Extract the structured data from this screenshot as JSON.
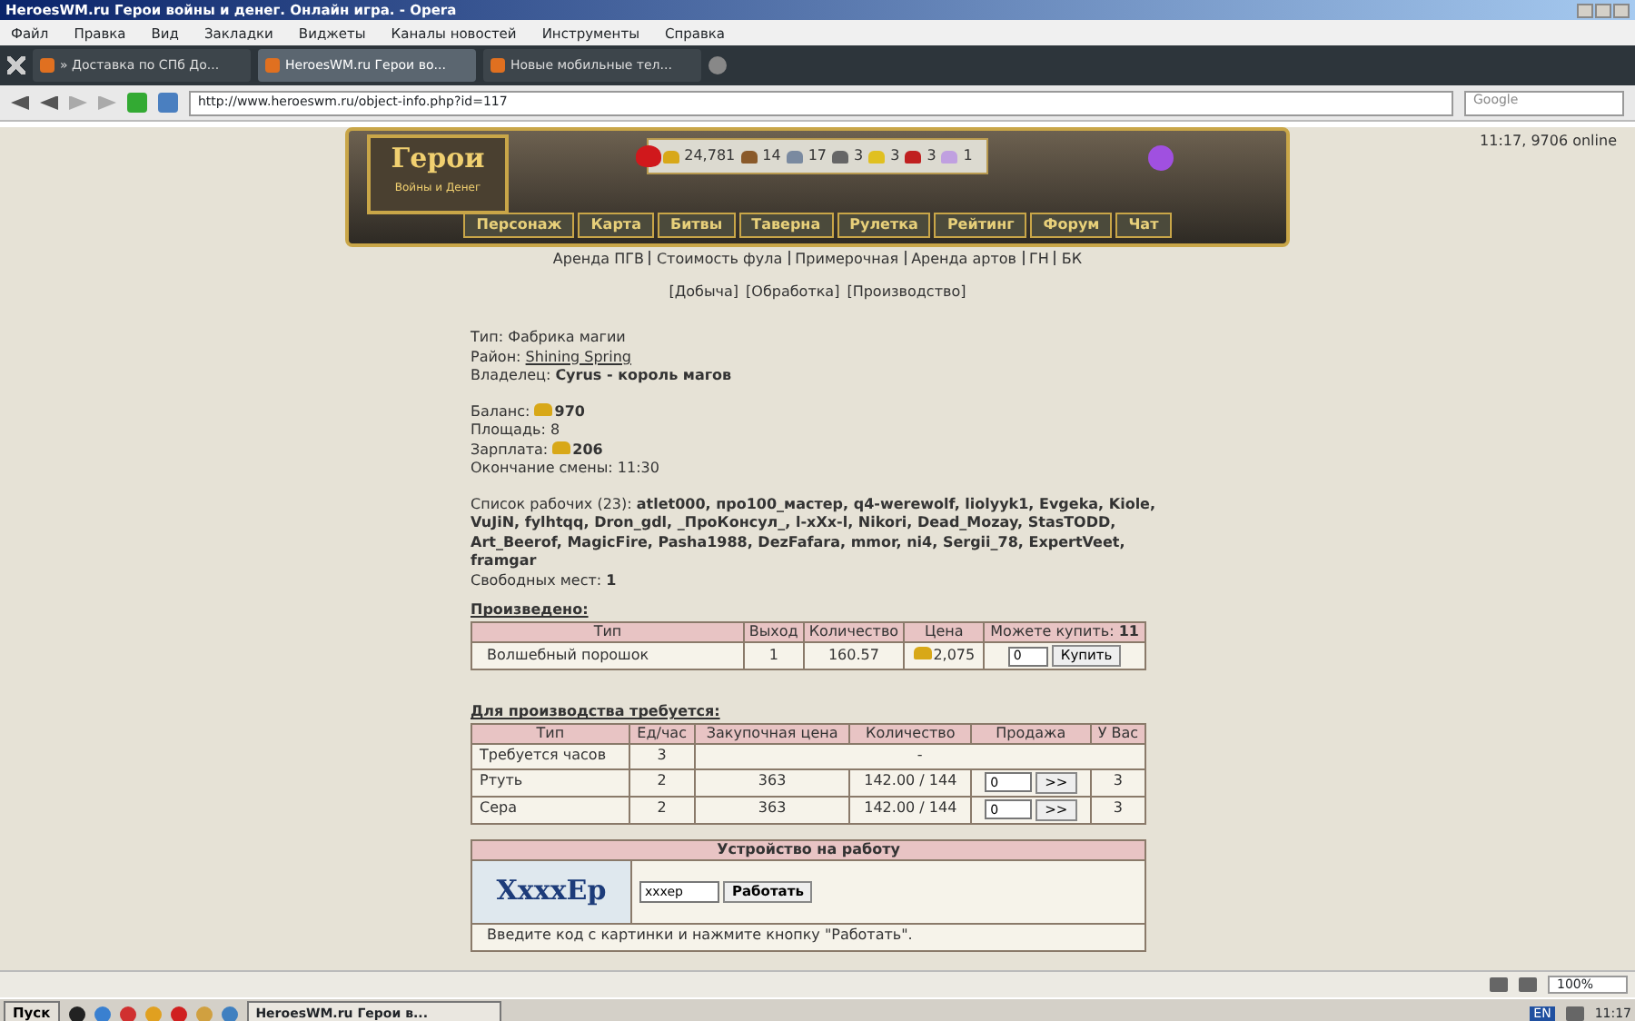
{
  "window": {
    "title": "HeroesWM.ru Герои войны и денег. Онлайн игра. - Opera"
  },
  "menu": [
    "Файл",
    "Правка",
    "Вид",
    "Закладки",
    "Виджеты",
    "Каналы новостей",
    "Инструменты",
    "Справка"
  ],
  "tabs": [
    {
      "label": "» Доставка по СПб До...",
      "selected": false
    },
    {
      "label": "HeroesWM.ru Герои во...",
      "selected": true
    },
    {
      "label": "Новые мобильные тел...",
      "selected": false
    }
  ],
  "address_bar": {
    "url": "http://www.heroeswm.ru/object-info.php?id=117",
    "search_placeholder": "Google"
  },
  "online": "11:17, 9706 online",
  "logo": {
    "title": "Герои",
    "subtitle": "Войны и Денег"
  },
  "resources": [
    {
      "amount": "24,781"
    },
    {
      "amount": "14"
    },
    {
      "amount": "17"
    },
    {
      "amount": "3"
    },
    {
      "amount": "3"
    },
    {
      "amount": "3"
    },
    {
      "amount": "1"
    }
  ],
  "nav": [
    "Персонаж",
    "Карта",
    "Битвы",
    "Таверна",
    "Рулетка",
    "Рейтинг",
    "Форум",
    "Чат"
  ],
  "links": [
    "Аренда ПГВ",
    "Стоимость фула",
    "Примерочная",
    "Аренда артов",
    "ГН",
    "БК"
  ],
  "sub_links": [
    "[Добыча]",
    "[Обработка]",
    "[Производство]"
  ],
  "info": [
    [
      {
        "label": "Тип:",
        "value": "Фабрика магии",
        "kind": "plain"
      },
      {
        "label": "Район:",
        "value": "Shining Spring",
        "kind": "link"
      },
      {
        "label": "Владелец:",
        "value": "Cyrus - король магов",
        "kind": "bold"
      }
    ],
    [
      {
        "label": "Баланс:",
        "value": "970",
        "kind": "gold"
      },
      {
        "label": "Площадь:",
        "value": "8",
        "kind": "plain"
      },
      {
        "label": "Зарплата:",
        "value": "206",
        "kind": "gold"
      },
      {
        "label": "Окончание смены:",
        "value": "11:30",
        "kind": "plain"
      }
    ],
    [
      {
        "label": "Список рабочих (23):",
        "value": "atlet000, про100_мастер, q4-werewolf, liolyyk1, Evgeka, Kiole, VuJiN, fylhtqq, Dron_gdl, _ПроКонсул_, l-xXx-l, Nikori, Dead_Mozay, StasTODD, Art_Beerof, MagicFire, Pasha1988, DezFafara, mmor, ni4, Sergii_78, ExpertVeet, framgar",
        "kind": "bold"
      },
      {
        "label": "Свободных мест:",
        "value": "1",
        "kind": "bold"
      }
    ]
  ],
  "produced": {
    "title": "Произведено:",
    "columns": [
      "Тип",
      "Выход",
      "Количество",
      "Цена"
    ],
    "buy_label": "Можете купить:",
    "buy_count": "11",
    "rows": [
      {
        "type": "Волшебный порошок",
        "output": "1",
        "quantity": "160.57",
        "price": "2,075",
        "amount": "0",
        "button": "Купить"
      }
    ]
  },
  "required": {
    "title": "Для производства требуется:",
    "columns": [
      "Тип",
      "Ед/час",
      "Закупочная цена",
      "Количество",
      "Продажа",
      "У Вас"
    ],
    "rows": [
      {
        "kind": "hours",
        "type": "Требуется часов",
        "per_hour": "3",
        "note": "-"
      },
      {
        "kind": "resource",
        "type": "Ртуть",
        "per_hour": "2",
        "price": "363",
        "quantity": "142.00 / 144",
        "amount": "0",
        "button": ">>",
        "have": "3"
      },
      {
        "kind": "resource",
        "type": "Сера",
        "per_hour": "2",
        "price": "363",
        "quantity": "142.00 / 144",
        "amount": "0",
        "button": ">>",
        "have": "3"
      }
    ]
  },
  "job": {
    "title": "Устройство на работу",
    "captcha": "XxxxEp",
    "code": "xxxep",
    "button": "Работать",
    "hint": "Введите код с картинки и нажмите кнопку \"Работать\"."
  },
  "status_bar": {
    "zoom": "100%"
  },
  "taskbar": {
    "start": "Пуск",
    "window": "HeroesWM.ru Герои в...",
    "language": "EN",
    "clock": "11:17"
  }
}
